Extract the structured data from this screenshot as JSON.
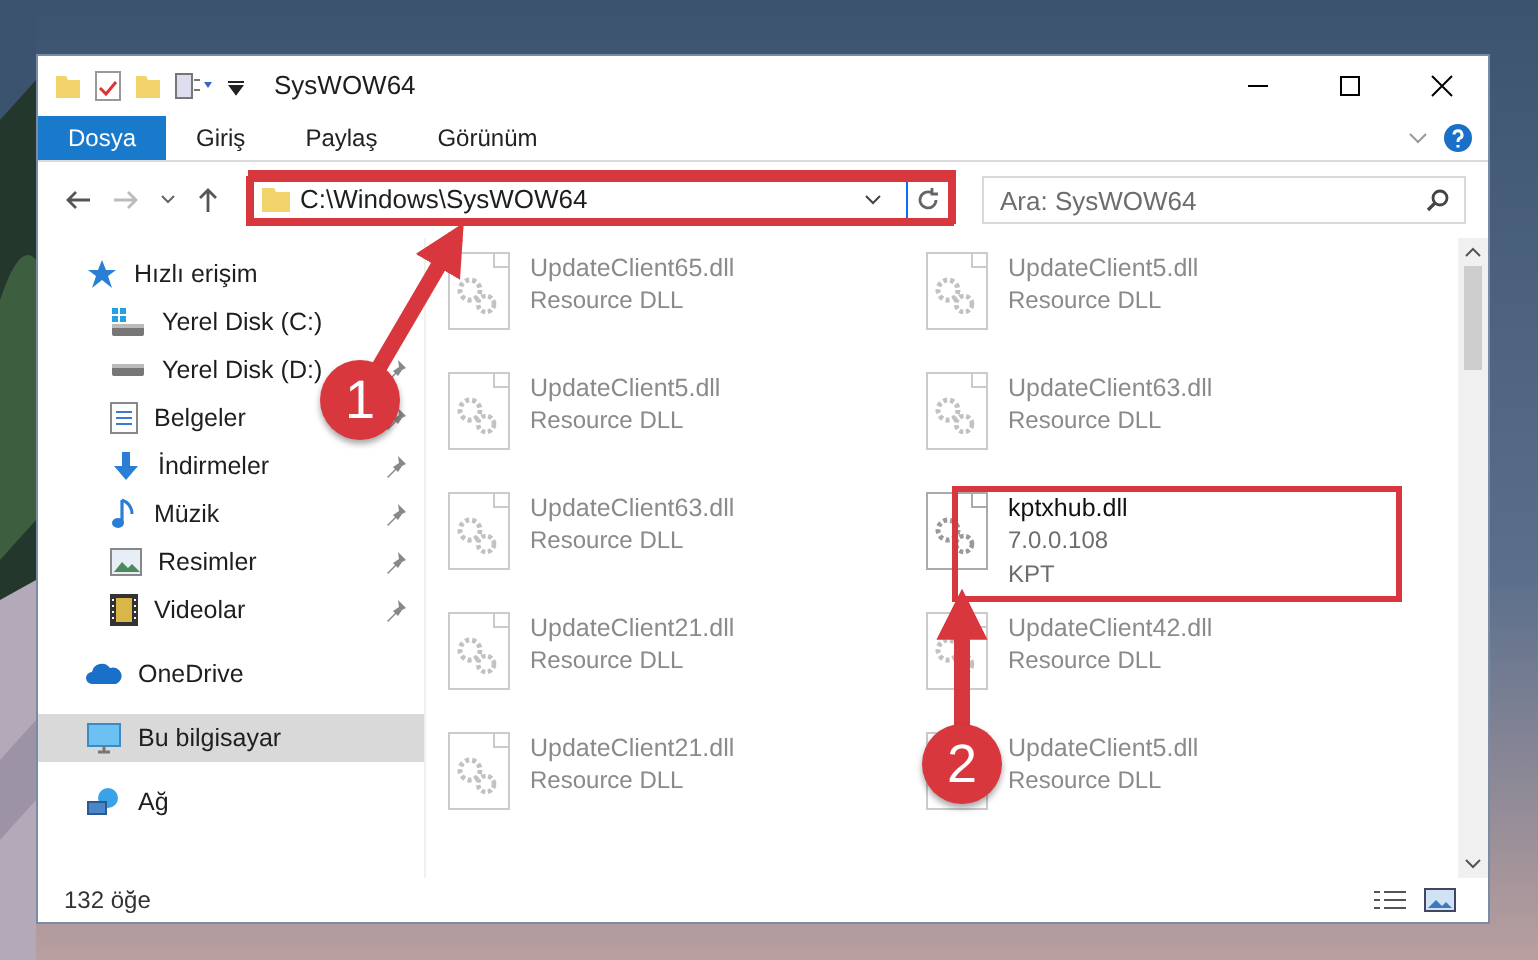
{
  "window": {
    "title": "SysWOW64"
  },
  "ribbon_tabs": [
    {
      "label": "Dosya",
      "selected": true
    },
    {
      "label": "Giriş",
      "selected": false
    },
    {
      "label": "Paylaş",
      "selected": false
    },
    {
      "label": "Görünüm",
      "selected": false
    }
  ],
  "address": {
    "path": "C:\\Windows\\SysWOW64"
  },
  "search": {
    "placeholder": "Ara: SysWOW64"
  },
  "nav": [
    {
      "label": "Hızlı erişim",
      "kind": "star",
      "selected": false,
      "children": [
        {
          "label": "Yerel Disk (C:)",
          "kind": "drive-win",
          "pinned": false,
          "selected": false
        },
        {
          "label": "Yerel Disk (D:)",
          "kind": "drive",
          "pinned": true,
          "selected": false
        },
        {
          "label": "Belgeler",
          "kind": "docs",
          "pinned": true,
          "selected": false
        },
        {
          "label": "İndirmeler",
          "kind": "download",
          "pinned": true,
          "selected": false
        },
        {
          "label": "Müzik",
          "kind": "music",
          "pinned": true,
          "selected": false
        },
        {
          "label": "Resimler",
          "kind": "pictures",
          "pinned": true,
          "selected": false
        },
        {
          "label": "Videolar",
          "kind": "videos",
          "pinned": true,
          "selected": false
        }
      ]
    },
    {
      "label": "OneDrive",
      "kind": "cloud",
      "selected": false
    },
    {
      "label": "Bu bilgisayar",
      "kind": "pc",
      "selected": true
    },
    {
      "label": "Ağ",
      "kind": "network",
      "selected": false
    }
  ],
  "files": [
    {
      "name": "UpdateClient65.dll",
      "details": [
        "Resource DLL"
      ],
      "blurred": true
    },
    {
      "name": "UpdateClient5.dll",
      "details": [
        "Resource DLL"
      ],
      "blurred": true
    },
    {
      "name": "UpdateClient5.dll",
      "details": [
        "Resource DLL"
      ],
      "blurred": true
    },
    {
      "name": "UpdateClient63.dll",
      "details": [
        "Resource DLL"
      ],
      "blurred": true
    },
    {
      "name": "UpdateClient63.dll",
      "details": [
        "Resource DLL"
      ],
      "blurred": true
    },
    {
      "name": "kptxhub.dll",
      "details": [
        "7.0.0.108",
        "KPT"
      ],
      "blurred": false
    },
    {
      "name": "UpdateClient21.dll",
      "details": [
        "Resource DLL"
      ],
      "blurred": true
    },
    {
      "name": "UpdateClient42.dll",
      "details": [
        "Resource DLL"
      ],
      "blurred": true
    },
    {
      "name": "UpdateClient21.dll",
      "details": [
        "Resource DLL"
      ],
      "blurred": true
    },
    {
      "name": "UpdateClient5.dll",
      "details": [
        "Resource DLL"
      ],
      "blurred": true
    }
  ],
  "status_bar": {
    "count": "132 öğe"
  },
  "annotations": [
    {
      "number": "1"
    },
    {
      "number": "2"
    }
  ]
}
